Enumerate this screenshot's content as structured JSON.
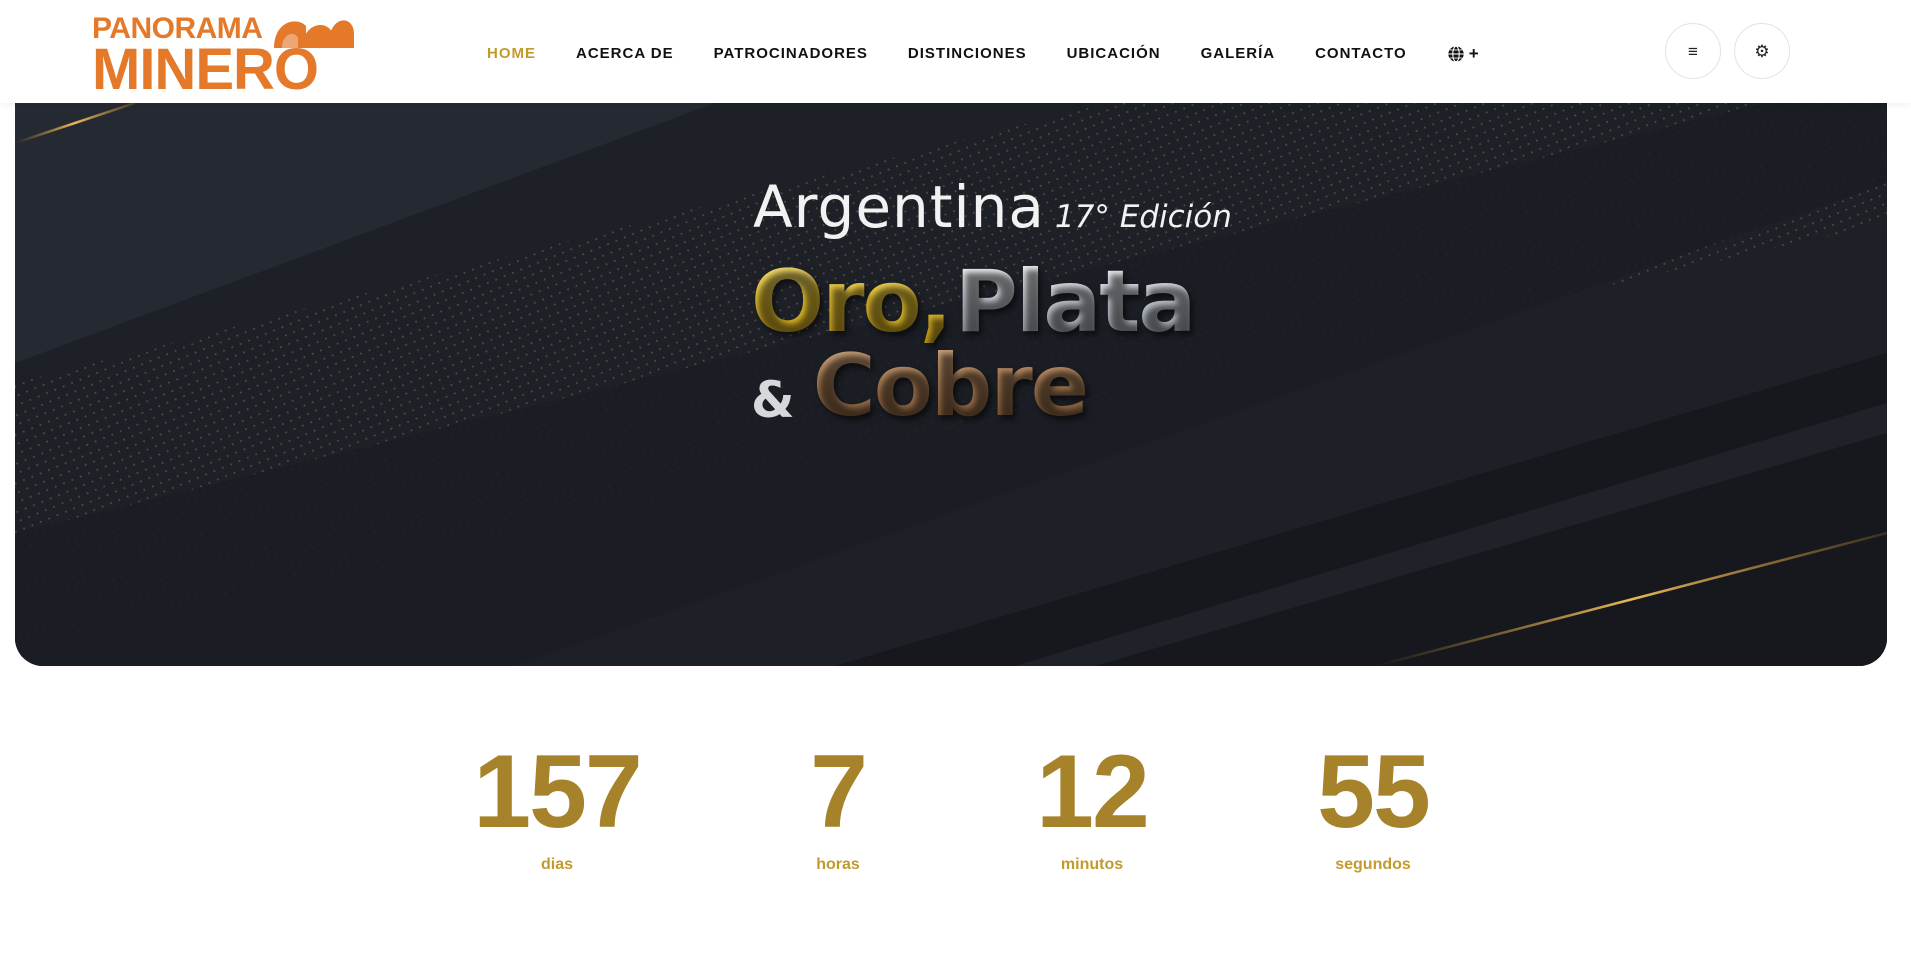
{
  "brand": {
    "logo_top": "PANORAMA",
    "logo_bottom": "MINERO",
    "logo_color": "#e5792a"
  },
  "nav": {
    "items": [
      {
        "label": "HOME",
        "active": true
      },
      {
        "label": "ACERCA DE"
      },
      {
        "label": "PATROCINADORES"
      },
      {
        "label": "DISTINCIONES"
      },
      {
        "label": "UBICACIÓN"
      },
      {
        "label": "GALERÍA"
      },
      {
        "label": "CONTACTO"
      }
    ],
    "language_icon": "globe-icon",
    "language_suffix": "+",
    "active_color": "#c39a2c"
  },
  "header_buttons": {
    "menu_icon": "≡",
    "settings_icon": "⚙"
  },
  "hero": {
    "country": "Argentina",
    "edition": "17° Edición",
    "word_gold": "Oro,",
    "word_silver": "Plata",
    "ampersand": "&",
    "word_copper": "Cobre"
  },
  "countdown": {
    "accent_color": "#a6832a",
    "items": [
      {
        "value": "157",
        "label": "dias"
      },
      {
        "value": "7",
        "label": "horas"
      },
      {
        "value": "12",
        "label": "minutos"
      },
      {
        "value": "55",
        "label": "segundos"
      }
    ]
  }
}
